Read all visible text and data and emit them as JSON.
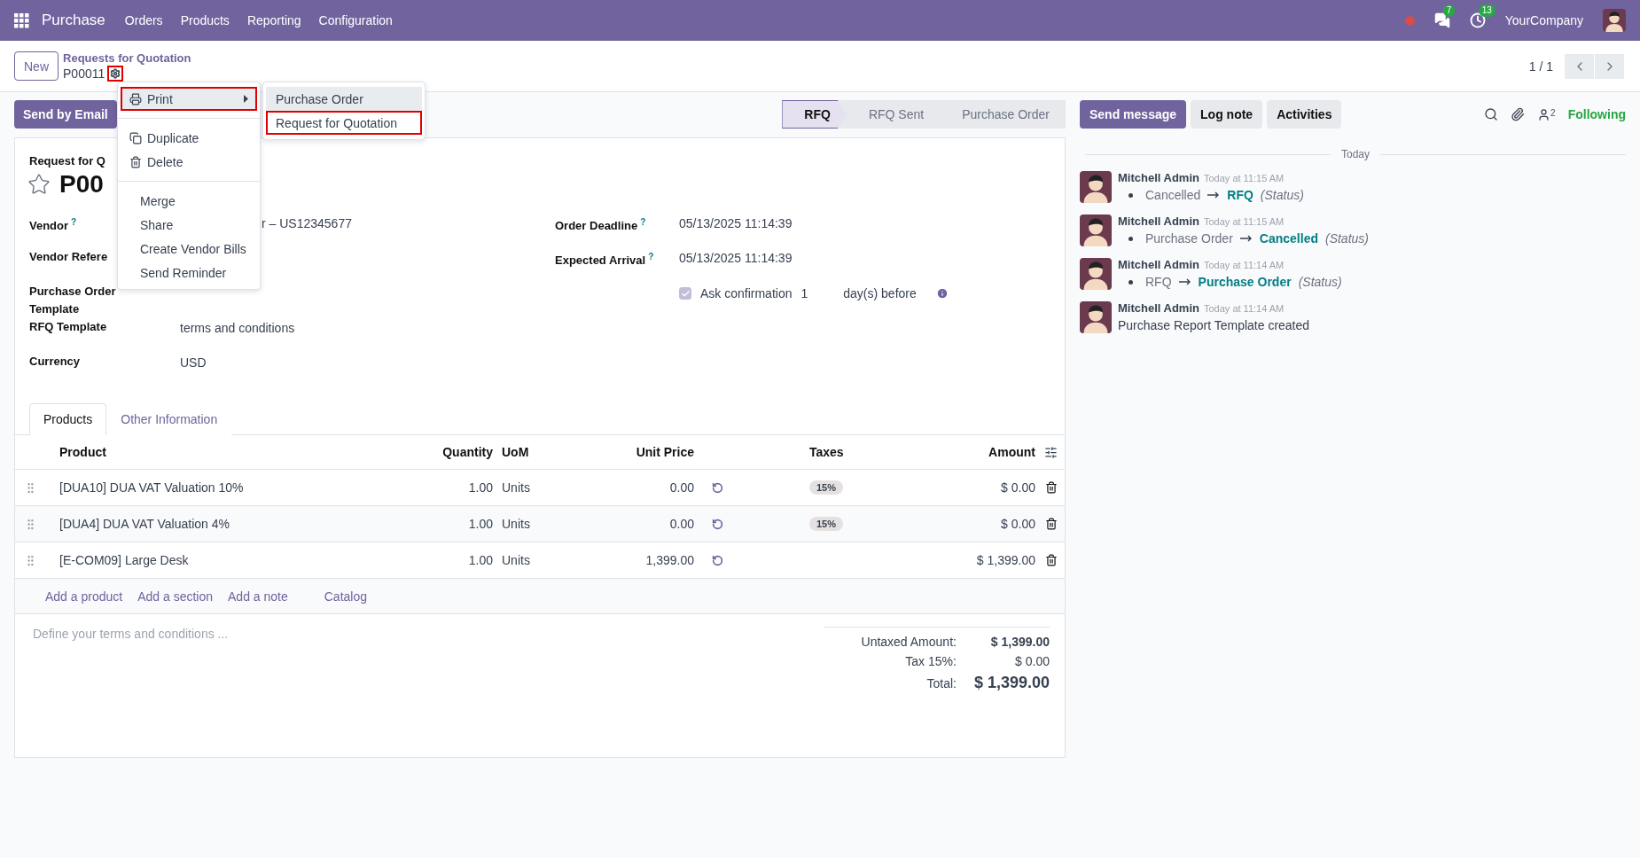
{
  "navbar": {
    "app": "Purchase",
    "menus": [
      "Orders",
      "Products",
      "Reporting",
      "Configuration"
    ],
    "chat_badge": "7",
    "activity_badge": "13",
    "company": "YourCompany"
  },
  "control_panel": {
    "new_label": "New",
    "breadcrumb": "Requests for Quotation",
    "record": "P00011",
    "gear_highlighted": true,
    "pager": "1 / 1"
  },
  "send_email": "Send by Email",
  "statusbar": [
    {
      "label": "RFQ",
      "selected": true
    },
    {
      "label": "RFQ Sent",
      "selected": false
    },
    {
      "label": "Purchase Order",
      "selected": false
    }
  ],
  "action_menu": {
    "groups": [
      [
        {
          "kind": "print",
          "label": "Print",
          "hovered": true,
          "highlighted": true
        }
      ],
      [
        {
          "kind": "duplicate",
          "label": "Duplicate",
          "hovered": false,
          "highlighted": false
        },
        {
          "kind": "delete",
          "label": "Delete",
          "hovered": false,
          "highlighted": false
        }
      ],
      [
        {
          "kind": "action",
          "label": "Merge",
          "hovered": false,
          "highlighted": false
        },
        {
          "kind": "action",
          "label": "Share",
          "hovered": false,
          "highlighted": false
        },
        {
          "kind": "action",
          "label": "Create Vendor Bills",
          "hovered": false,
          "highlighted": false
        },
        {
          "kind": "action",
          "label": "Send Reminder",
          "hovered": false,
          "highlighted": false
        }
      ]
    ],
    "submenu": [
      {
        "label": "Purchase Order",
        "hovered": true,
        "highlighted": false
      },
      {
        "label": "Request for Quotation",
        "hovered": false,
        "highlighted": true
      }
    ]
  },
  "form": {
    "title_label": "Request for Q",
    "title": "P00",
    "starred": false,
    "left_fields": [
      {
        "label": "Vendor",
        "help": "?",
        "value": "r – US12345677"
      },
      {
        "label": "Vendor Refere"
      },
      {
        "label": "Purchase Order Template"
      },
      {
        "label": "RFQ Template",
        "value": "terms and conditions"
      },
      {
        "label": "Currency",
        "value": "USD"
      }
    ],
    "right_fields": [
      {
        "label": "Order Deadline",
        "help": "?",
        "value": "05/13/2025 11:14:39"
      },
      {
        "label": "Expected Arrival",
        "help": "?",
        "value": "05/13/2025 11:14:39"
      }
    ],
    "confirmation": {
      "checked": true,
      "label": "Ask confirmation",
      "days": "1",
      "suffix": "day(s) before"
    },
    "tabs": [
      {
        "label": "Products",
        "selected": true
      },
      {
        "label": "Other Information",
        "selected": false
      }
    ],
    "table": {
      "columns": [
        "Product",
        "Quantity",
        "UoM",
        "Unit Price",
        "Taxes",
        "Amount"
      ],
      "rows": [
        {
          "product": "[DUA10] DUA VAT Valuation 10%",
          "quantity": "1.00",
          "uom": "Units",
          "unit_price": "0.00",
          "taxes": "15%",
          "amount": "$ 0.00"
        },
        {
          "product": "[DUA4] DUA VAT Valuation 4%",
          "quantity": "1.00",
          "uom": "Units",
          "unit_price": "0.00",
          "taxes": "15%",
          "amount": "$ 0.00"
        },
        {
          "product": "[E-COM09] Large Desk",
          "quantity": "1.00",
          "uom": "Units",
          "unit_price": "1,399.00",
          "amount": "$ 1,399.00"
        }
      ]
    },
    "add_links": [
      "Add a product",
      "Add a section",
      "Add a note",
      "Catalog"
    ],
    "terms_placeholder": "Define your terms and conditions ...",
    "totals": [
      {
        "kind": "subtotal",
        "label": "Untaxed Amount:",
        "value": "$ 1,399.00"
      },
      {
        "kind": "tax",
        "label": "Tax 15%:",
        "value": "$ 0.00"
      },
      {
        "kind": "total",
        "label": "Total:",
        "value": "$ 1,399.00"
      }
    ]
  },
  "chatter": {
    "buttons": [
      {
        "label": "Send message",
        "selected": true
      },
      {
        "label": "Log note",
        "selected": false
      },
      {
        "label": "Activities",
        "selected": false
      }
    ],
    "followers_count": "2",
    "follow_label": "Following",
    "divider": "Today",
    "messages": [
      {
        "kind": "tracking",
        "author": "Mitchell Admin",
        "time": "Today at 11:15 AM",
        "old": "Cancelled",
        "new": "RFQ",
        "field": "(Status)"
      },
      {
        "kind": "tracking",
        "author": "Mitchell Admin",
        "time": "Today at 11:15 AM",
        "old": "Purchase Order",
        "new": "Cancelled",
        "field": "(Status)"
      },
      {
        "kind": "tracking",
        "author": "Mitchell Admin",
        "time": "Today at 11:14 AM",
        "old": "RFQ",
        "new": "Purchase Order",
        "field": "(Status)"
      },
      {
        "kind": "text",
        "author": "Mitchell Admin",
        "time": "Today at 11:14 AM",
        "body": "Purchase Report Template created"
      }
    ]
  }
}
